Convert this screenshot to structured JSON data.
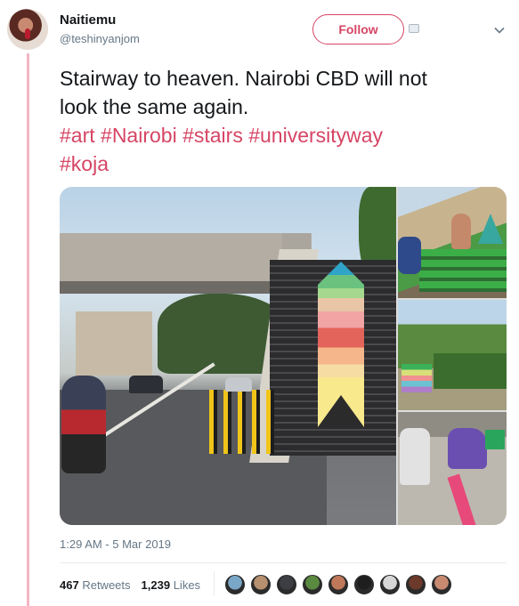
{
  "user": {
    "name": "Naitiemu",
    "handle": "@teshinyanjom"
  },
  "follow": {
    "label": "Follow"
  },
  "tweet": {
    "text_line1": "Stairway to heaven. Nairobi CBD will not",
    "text_line2": "look the same again.",
    "hashtags_line1": [
      "#art",
      "#Nairobi",
      "#stairs",
      "#universityway"
    ],
    "hashtags_line2": [
      "#koja"
    ]
  },
  "timestamp": "1:29 AM - 5 Mar 2019",
  "stats": {
    "retweets_count": "467",
    "retweets_label": "Retweets",
    "likes_count": "1,239",
    "likes_label": "Likes"
  },
  "colors": {
    "accent": "#d64564",
    "thread_line": "#f3b5c4",
    "muted": "#657786"
  },
  "likers": [
    "#7aa7c7",
    "#b79070",
    "#3d3d44",
    "#5a8a3f",
    "#c0785a",
    "#1e1e1e",
    "#d7d7d7",
    "#6b3a2a",
    "#c98a72"
  ]
}
